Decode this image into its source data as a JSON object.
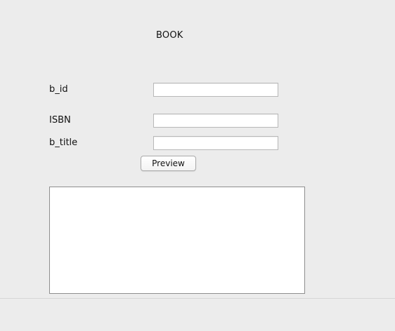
{
  "form": {
    "title": "BOOK",
    "fields": [
      {
        "label": "b_id",
        "value": "",
        "placeholder": ""
      },
      {
        "label": "ISBN",
        "value": "",
        "placeholder": ""
      },
      {
        "label": "b_title",
        "value": "",
        "placeholder": ""
      }
    ],
    "preview_button_label": "Preview",
    "output_text": ""
  }
}
